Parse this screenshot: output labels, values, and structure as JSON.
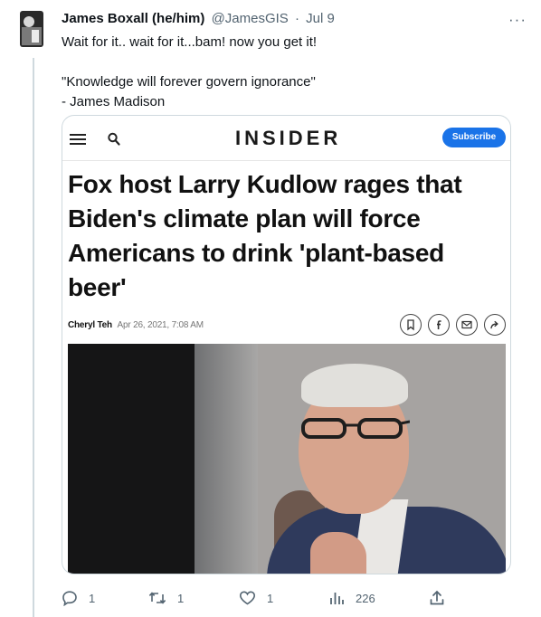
{
  "tweet": {
    "author_name": "James Boxall (he/him)",
    "author_handle": "@JamesGIS",
    "separator": "·",
    "time": "Jul 9",
    "text_lines": [
      "Wait for it.. wait for it...bam! now you get it!",
      "",
      "\"Knowledge will forever govern ignorance\"",
      "- James Madison"
    ]
  },
  "embedded_article": {
    "publication": "INSIDER",
    "subscribe_label": "Subscribe",
    "headline_lines": [
      "Fox host Larry Kudlow rages that",
      "Biden's climate plan will force",
      "Americans to drink 'plant-based",
      "beer'"
    ],
    "author": "Cheryl Teh",
    "date": "Apr 26, 2021, 7:08 AM",
    "share_icons": [
      "bookmark-icon",
      "facebook-icon",
      "email-icon",
      "share-arrow-icon"
    ]
  },
  "actions": {
    "reply_count": "1",
    "retweet_count": "1",
    "like_count": "1",
    "views_count": "226"
  },
  "colors": {
    "insider_blue": "#1a73e8",
    "muted_text": "#536471",
    "thread_line": "#cfd9de"
  }
}
